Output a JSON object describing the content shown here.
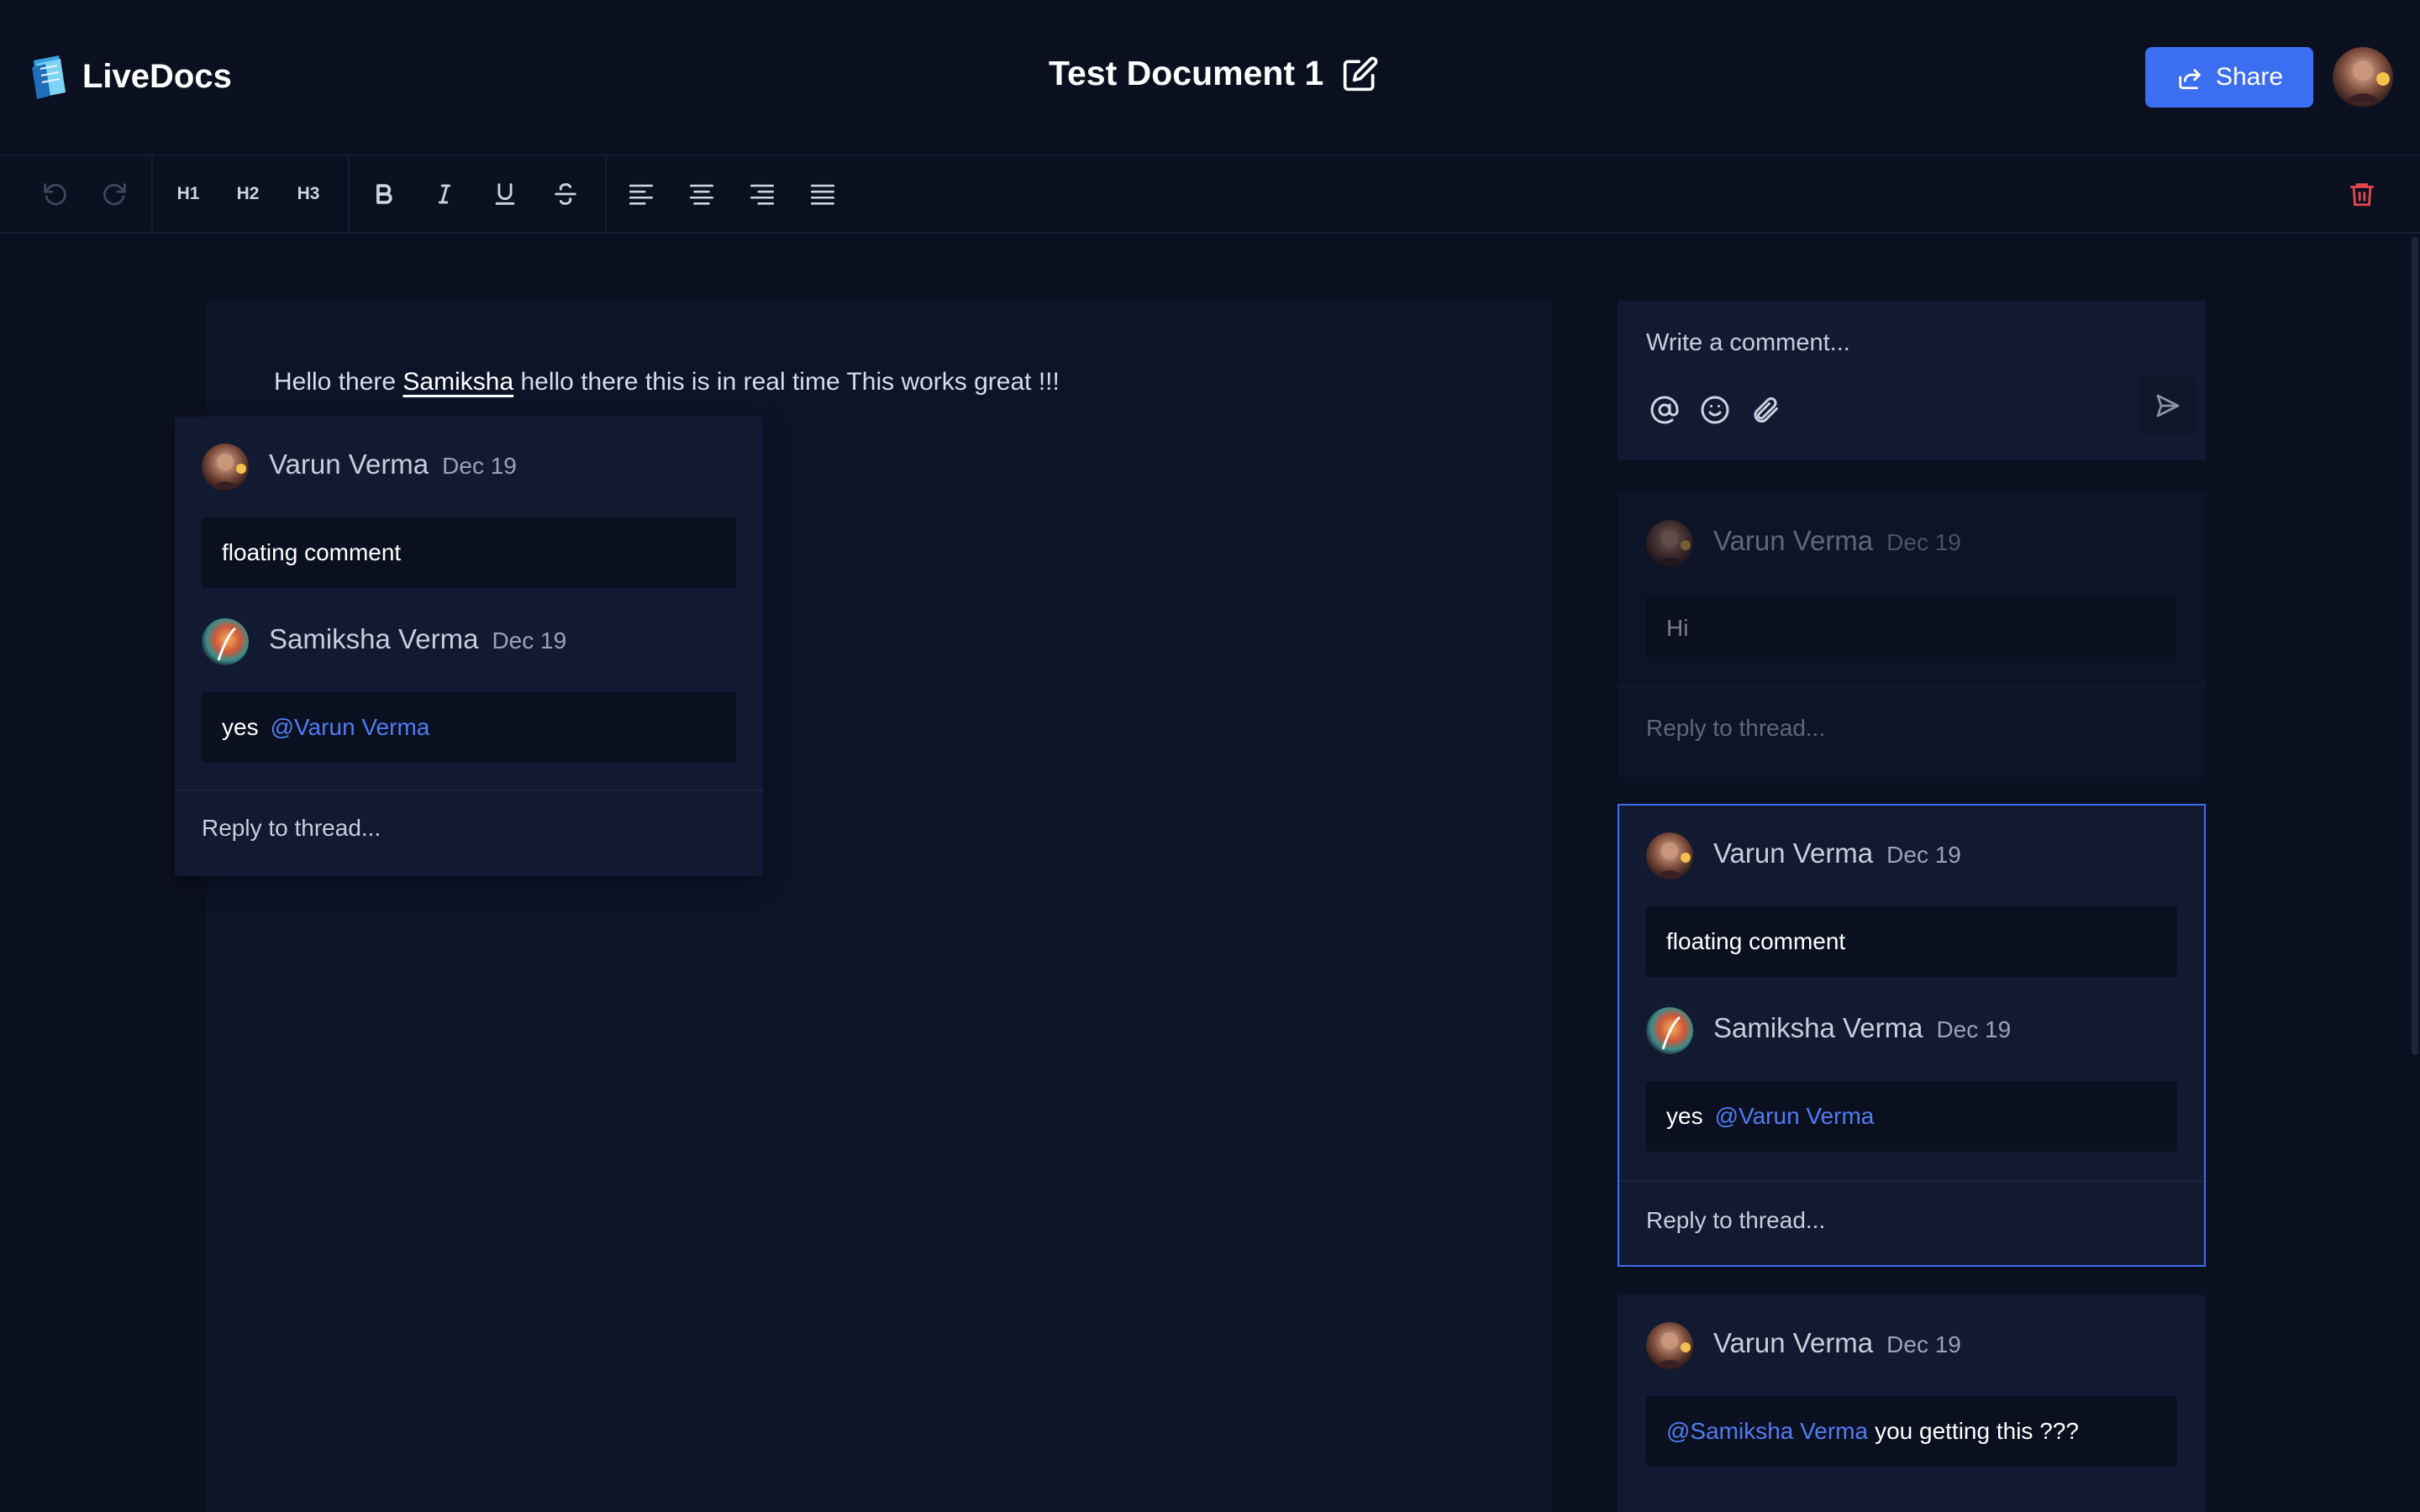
{
  "app": {
    "name": "LiveDocs"
  },
  "document": {
    "title": "Test Document 1",
    "content": {
      "before": "Hello there ",
      "highlight": "Samiksha",
      "after": " hello there this is in real time This works great !!!"
    }
  },
  "header": {
    "share_label": "Share"
  },
  "toolbar": {
    "h1": "H1",
    "h2": "H2",
    "h3": "H3"
  },
  "floating_thread": {
    "comments": [
      {
        "author": "Varun Verma",
        "date": "Dec 19",
        "text": "floating comment",
        "mention": ""
      },
      {
        "author": "Samiksha Verma",
        "date": "Dec 19",
        "text": "yes",
        "mention": "@Varun Verma"
      }
    ],
    "reply_placeholder": "Reply to thread..."
  },
  "sidebar": {
    "composer_placeholder": "Write a comment...",
    "threads": [
      {
        "comments": [
          {
            "author": "Varun Verma",
            "date": "Dec 19",
            "text": "Hi"
          }
        ],
        "reply_placeholder": "Reply to thread..."
      },
      {
        "comments": [
          {
            "author": "Varun Verma",
            "date": "Dec 19",
            "text": "floating comment"
          },
          {
            "author": "Samiksha Verma",
            "date": "Dec 19",
            "text": "yes",
            "mention": "@Varun Verma"
          }
        ],
        "reply_placeholder": "Reply to thread..."
      },
      {
        "comments": [
          {
            "author": "Varun Verma",
            "date": "Dec 19",
            "mention": "@Samiksha Verma",
            "text": "you getting this ???"
          }
        ]
      }
    ]
  },
  "colors": {
    "accent": "#3b6ef0",
    "mention": "#4f7df2",
    "danger": "#e5484d",
    "background": "#0b1020"
  }
}
